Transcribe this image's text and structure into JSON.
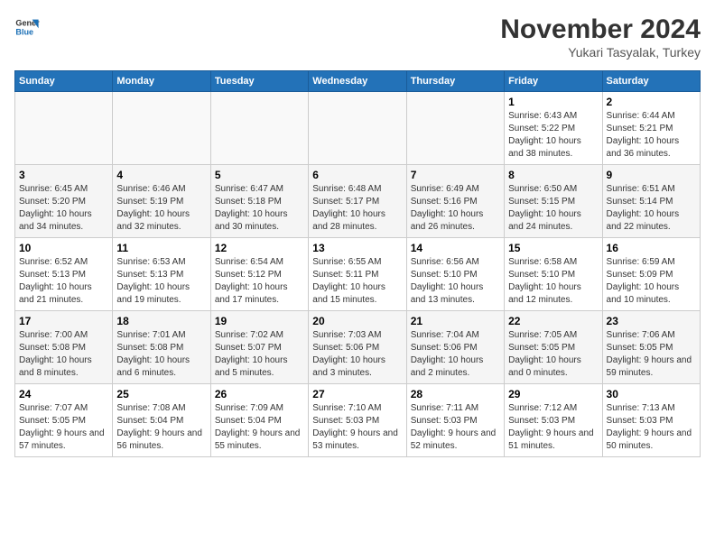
{
  "header": {
    "logo": {
      "general": "General",
      "blue": "Blue"
    },
    "title": "November 2024",
    "subtitle": "Yukari Tasyalak, Turkey"
  },
  "days_of_week": [
    "Sunday",
    "Monday",
    "Tuesday",
    "Wednesday",
    "Thursday",
    "Friday",
    "Saturday"
  ],
  "weeks": [
    [
      {
        "day": "",
        "info": ""
      },
      {
        "day": "",
        "info": ""
      },
      {
        "day": "",
        "info": ""
      },
      {
        "day": "",
        "info": ""
      },
      {
        "day": "",
        "info": ""
      },
      {
        "day": "1",
        "info": "Sunrise: 6:43 AM\nSunset: 5:22 PM\nDaylight: 10 hours and 38 minutes."
      },
      {
        "day": "2",
        "info": "Sunrise: 6:44 AM\nSunset: 5:21 PM\nDaylight: 10 hours and 36 minutes."
      }
    ],
    [
      {
        "day": "3",
        "info": "Sunrise: 6:45 AM\nSunset: 5:20 PM\nDaylight: 10 hours and 34 minutes."
      },
      {
        "day": "4",
        "info": "Sunrise: 6:46 AM\nSunset: 5:19 PM\nDaylight: 10 hours and 32 minutes."
      },
      {
        "day": "5",
        "info": "Sunrise: 6:47 AM\nSunset: 5:18 PM\nDaylight: 10 hours and 30 minutes."
      },
      {
        "day": "6",
        "info": "Sunrise: 6:48 AM\nSunset: 5:17 PM\nDaylight: 10 hours and 28 minutes."
      },
      {
        "day": "7",
        "info": "Sunrise: 6:49 AM\nSunset: 5:16 PM\nDaylight: 10 hours and 26 minutes."
      },
      {
        "day": "8",
        "info": "Sunrise: 6:50 AM\nSunset: 5:15 PM\nDaylight: 10 hours and 24 minutes."
      },
      {
        "day": "9",
        "info": "Sunrise: 6:51 AM\nSunset: 5:14 PM\nDaylight: 10 hours and 22 minutes."
      }
    ],
    [
      {
        "day": "10",
        "info": "Sunrise: 6:52 AM\nSunset: 5:13 PM\nDaylight: 10 hours and 21 minutes."
      },
      {
        "day": "11",
        "info": "Sunrise: 6:53 AM\nSunset: 5:13 PM\nDaylight: 10 hours and 19 minutes."
      },
      {
        "day": "12",
        "info": "Sunrise: 6:54 AM\nSunset: 5:12 PM\nDaylight: 10 hours and 17 minutes."
      },
      {
        "day": "13",
        "info": "Sunrise: 6:55 AM\nSunset: 5:11 PM\nDaylight: 10 hours and 15 minutes."
      },
      {
        "day": "14",
        "info": "Sunrise: 6:56 AM\nSunset: 5:10 PM\nDaylight: 10 hours and 13 minutes."
      },
      {
        "day": "15",
        "info": "Sunrise: 6:58 AM\nSunset: 5:10 PM\nDaylight: 10 hours and 12 minutes."
      },
      {
        "day": "16",
        "info": "Sunrise: 6:59 AM\nSunset: 5:09 PM\nDaylight: 10 hours and 10 minutes."
      }
    ],
    [
      {
        "day": "17",
        "info": "Sunrise: 7:00 AM\nSunset: 5:08 PM\nDaylight: 10 hours and 8 minutes."
      },
      {
        "day": "18",
        "info": "Sunrise: 7:01 AM\nSunset: 5:08 PM\nDaylight: 10 hours and 6 minutes."
      },
      {
        "day": "19",
        "info": "Sunrise: 7:02 AM\nSunset: 5:07 PM\nDaylight: 10 hours and 5 minutes."
      },
      {
        "day": "20",
        "info": "Sunrise: 7:03 AM\nSunset: 5:06 PM\nDaylight: 10 hours and 3 minutes."
      },
      {
        "day": "21",
        "info": "Sunrise: 7:04 AM\nSunset: 5:06 PM\nDaylight: 10 hours and 2 minutes."
      },
      {
        "day": "22",
        "info": "Sunrise: 7:05 AM\nSunset: 5:05 PM\nDaylight: 10 hours and 0 minutes."
      },
      {
        "day": "23",
        "info": "Sunrise: 7:06 AM\nSunset: 5:05 PM\nDaylight: 9 hours and 59 minutes."
      }
    ],
    [
      {
        "day": "24",
        "info": "Sunrise: 7:07 AM\nSunset: 5:05 PM\nDaylight: 9 hours and 57 minutes."
      },
      {
        "day": "25",
        "info": "Sunrise: 7:08 AM\nSunset: 5:04 PM\nDaylight: 9 hours and 56 minutes."
      },
      {
        "day": "26",
        "info": "Sunrise: 7:09 AM\nSunset: 5:04 PM\nDaylight: 9 hours and 55 minutes."
      },
      {
        "day": "27",
        "info": "Sunrise: 7:10 AM\nSunset: 5:03 PM\nDaylight: 9 hours and 53 minutes."
      },
      {
        "day": "28",
        "info": "Sunrise: 7:11 AM\nSunset: 5:03 PM\nDaylight: 9 hours and 52 minutes."
      },
      {
        "day": "29",
        "info": "Sunrise: 7:12 AM\nSunset: 5:03 PM\nDaylight: 9 hours and 51 minutes."
      },
      {
        "day": "30",
        "info": "Sunrise: 7:13 AM\nSunset: 5:03 PM\nDaylight: 9 hours and 50 minutes."
      }
    ]
  ]
}
